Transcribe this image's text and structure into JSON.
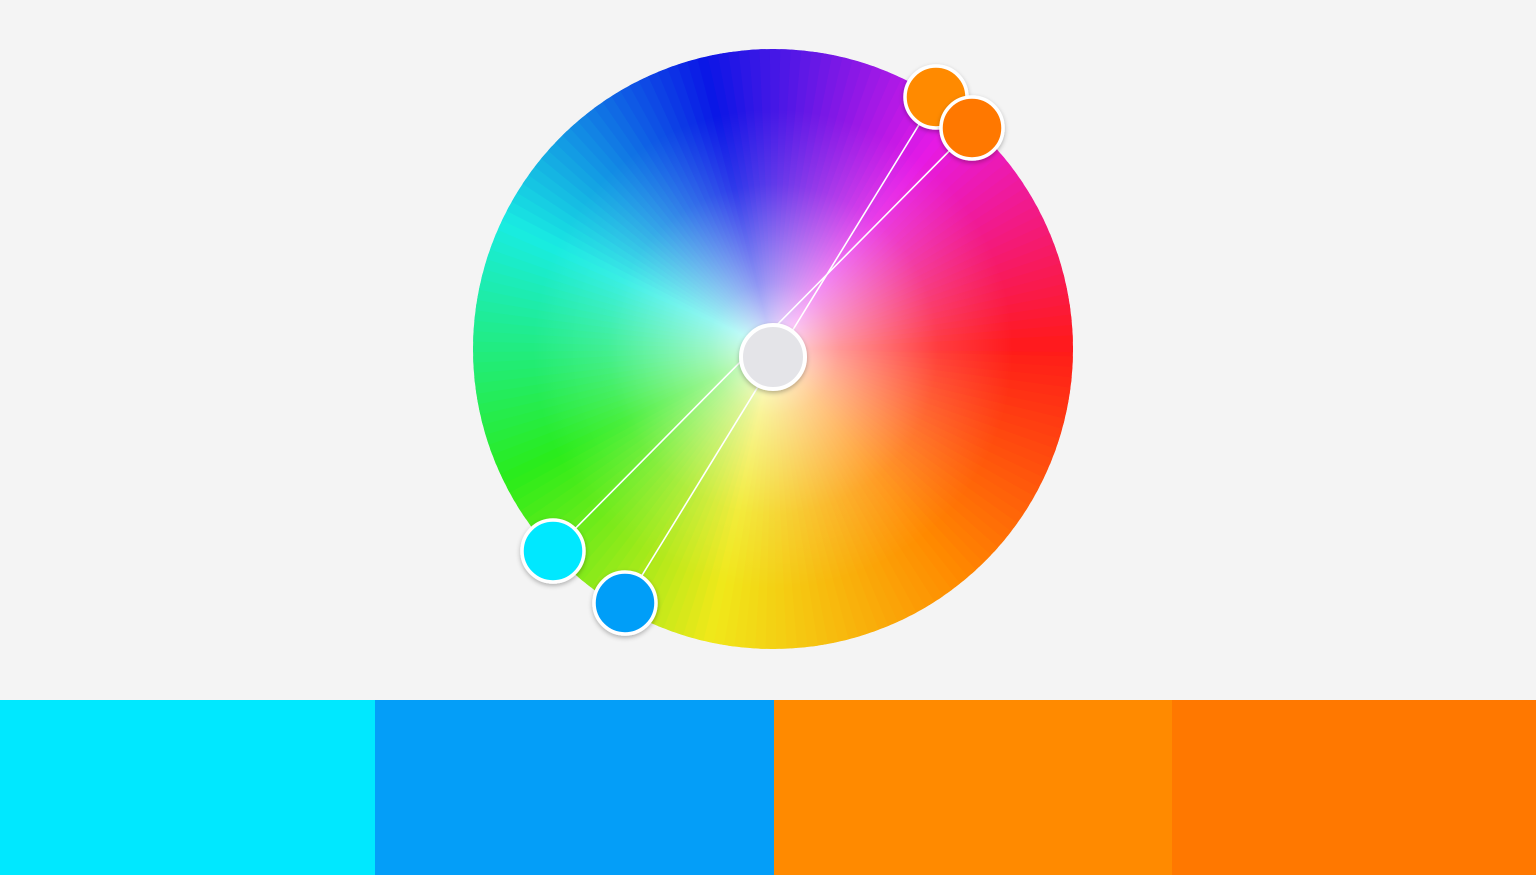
{
  "color_wheel": {
    "harmony_rule": "complementary",
    "center_color": "#e4e4e8",
    "ring_color": "#ffffff",
    "line_color": "#ffffff",
    "hue_stops": [
      "#ff1a1a",
      "#ff8a00",
      "#f0e81a",
      "#2aec1a",
      "#19ece2",
      "#0a16e6",
      "#e61ae6",
      "#ff1a1a"
    ],
    "handles": [
      {
        "id": "handle-1",
        "color": "#00e8ff"
      },
      {
        "id": "handle-2",
        "color": "#049ef8"
      },
      {
        "id": "handle-3",
        "color": "#ff8a00"
      },
      {
        "id": "handle-4",
        "color": "#ff7800"
      }
    ]
  },
  "palette": {
    "swatches": [
      {
        "color": "#00e8ff",
        "fraction": 0.244
      },
      {
        "color": "#049ef8",
        "fraction": 0.26
      },
      {
        "color": "#ff8a00",
        "fraction": 0.259
      },
      {
        "color": "#ff7800",
        "fraction": 0.237
      }
    ]
  }
}
